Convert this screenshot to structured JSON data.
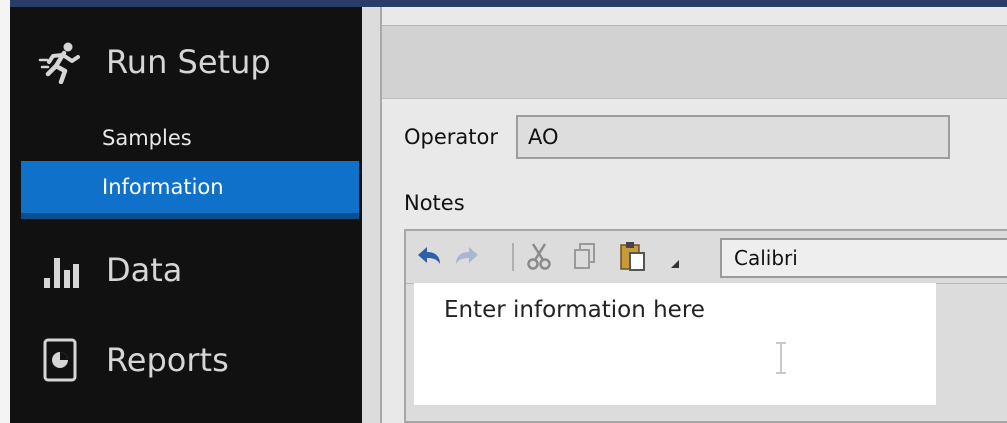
{
  "sidebar": {
    "run_setup": {
      "label": "Run Setup",
      "icon": "running-person-icon"
    },
    "items": [
      {
        "label": "Samples"
      },
      {
        "label": "Information",
        "selected": true
      }
    ],
    "data": {
      "label": "Data",
      "icon": "bar-chart-icon"
    },
    "reports": {
      "label": "Reports",
      "icon": "report-document-icon"
    }
  },
  "form": {
    "operator_label": "Operator",
    "operator_value": "AO",
    "notes_label": "Notes",
    "editor": {
      "font": "Calibri",
      "placeholder": "Enter information here",
      "toolbar_icons": [
        "undo-icon",
        "redo-icon",
        "cut-icon",
        "copy-icon",
        "paste-icon",
        "dropdown-arrow-icon"
      ]
    }
  },
  "colors": {
    "sidebar_bg": "#111111",
    "selection": "#0f71c9",
    "content_bg": "#e9e9e9"
  }
}
